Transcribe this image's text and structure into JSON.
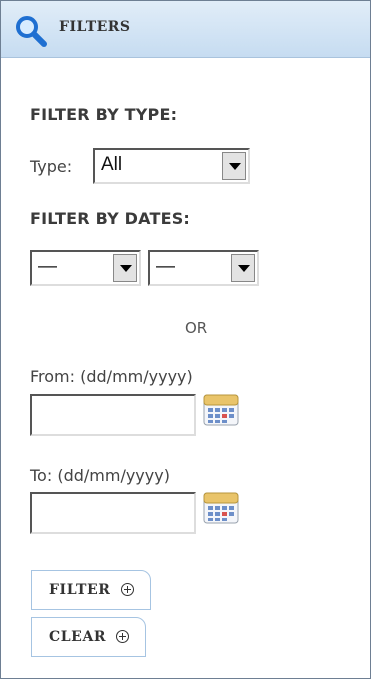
{
  "header": {
    "title": "FILTERS",
    "icon": "magnifier-icon"
  },
  "type_section": {
    "heading": "FILTER BY TYPE:",
    "type_label": "Type:",
    "type_value": "All"
  },
  "date_section": {
    "heading": "FILTER BY DATES:",
    "select1_value": "—",
    "select2_value": "—",
    "or_label": "OR",
    "from_label": "From: (dd/mm/yyyy)",
    "from_value": "",
    "to_label": "To: (dd/mm/yyyy)",
    "to_value": "",
    "calendar_icon": "calendar-icon"
  },
  "buttons": {
    "filter_label": "FILTER",
    "clear_label": "CLEAR"
  },
  "colors": {
    "header_bg": "#c6dcf1",
    "button_border": "#a6c4e2",
    "panel_border": "#6e7f93"
  }
}
